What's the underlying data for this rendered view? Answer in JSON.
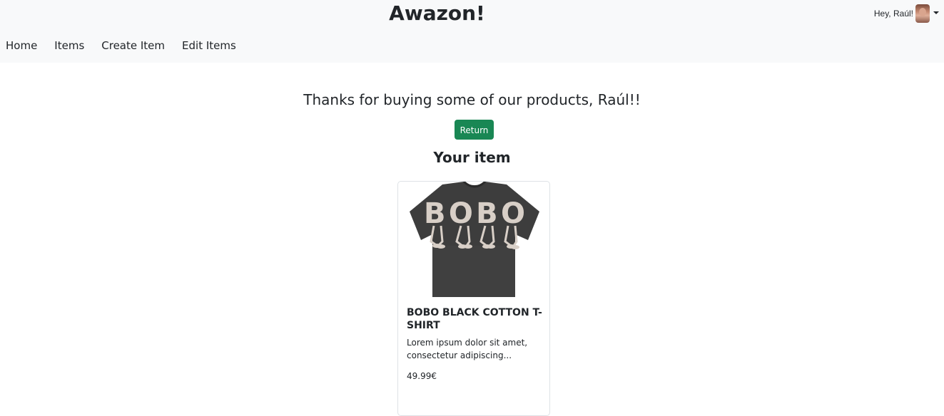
{
  "app": {
    "brand": "Awazon!",
    "user_greeting": "Hey, Raúl!"
  },
  "nav": {
    "items": [
      "Home",
      "Items",
      "Create Item",
      "Edit Items"
    ]
  },
  "main": {
    "thanks_message": "Thanks for buying some of our products, Raúl!!",
    "return_label": "Return",
    "section_title": "Your item",
    "product": {
      "title": "BOBO BLACK COTTON T-SHIRT",
      "description": "Lorem ipsum dolor sit amet, consectetur adipiscing...",
      "price": "49.99€",
      "image_print": "BOBO"
    }
  },
  "colors": {
    "navbar_bg": "#f8f9fa",
    "return_button": "#198754",
    "shirt": "#3c3c3c",
    "print": "#d8cfc7"
  }
}
